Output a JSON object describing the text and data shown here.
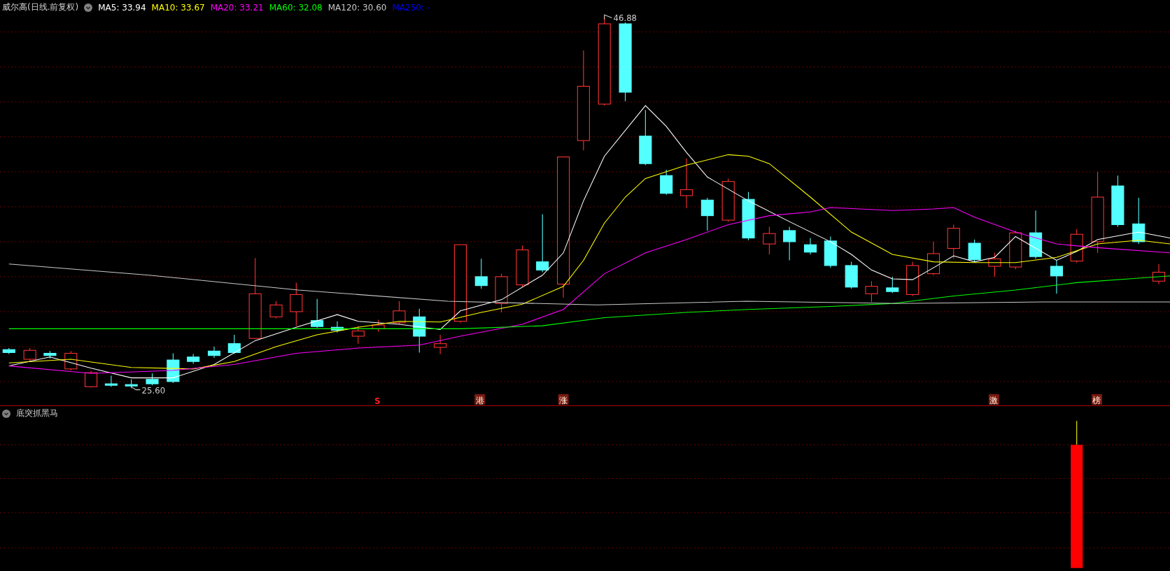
{
  "main_panel": {
    "title": "威尔高(日线.前复权)",
    "indicators": [
      {
        "text": "MA5: 33.94",
        "color": "#ffffff"
      },
      {
        "text": "MA10: 33.67",
        "color": "#ffff00"
      },
      {
        "text": "MA20: 33.21",
        "color": "#ff00ff"
      },
      {
        "text": "MA60: 32.08",
        "color": "#00ff00"
      },
      {
        "text": "MA120: 30.60",
        "color": "#c8c8c8"
      },
      {
        "text": "MA250: -",
        "color": "#0000ff"
      }
    ],
    "high_label": "46.88",
    "low_label": "25.60",
    "markers": [
      {
        "kind": "letter",
        "text": "S"
      },
      {
        "kind": "badge",
        "text": "港"
      },
      {
        "kind": "badge",
        "text": "涨"
      },
      {
        "kind": "badge",
        "text": "激"
      },
      {
        "kind": "badge",
        "text": "榜"
      }
    ]
  },
  "lower_panel": {
    "title": "底突抓黑马"
  }
}
